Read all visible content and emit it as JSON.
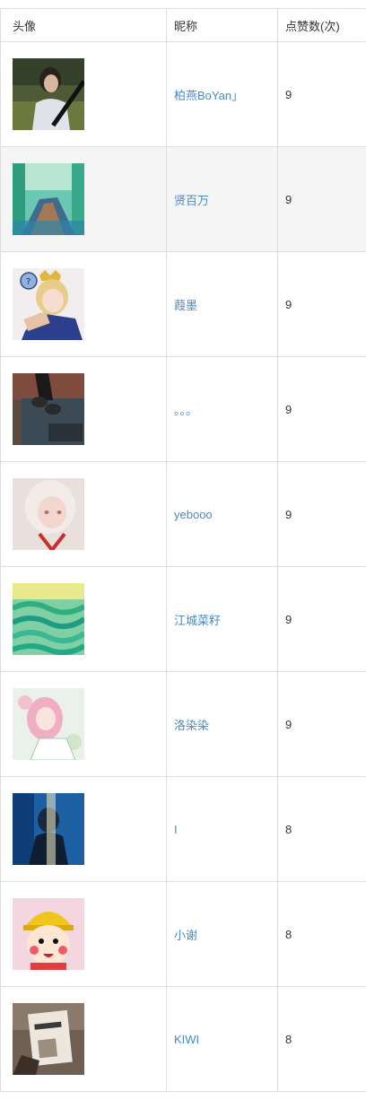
{
  "table": {
    "headers": {
      "avatar": "头像",
      "nickname": "昵称",
      "likes": "点赞数(次)"
    },
    "rows": [
      {
        "nickname": "柏燕BoYan」",
        "likes": "9",
        "avatar_icon": "avatar-photo-girl-outdoor"
      },
      {
        "nickname": "贤百万",
        "likes": "9",
        "avatar_icon": "avatar-illustration-forest-path"
      },
      {
        "nickname": "葭墨",
        "likes": "9",
        "avatar_icon": "avatar-anime-crowned-boy"
      },
      {
        "nickname": "。。。",
        "likes": "9",
        "avatar_icon": "avatar-photo-feet-sign"
      },
      {
        "nickname": "yebooo",
        "likes": "9",
        "avatar_icon": "avatar-anime-white-hair-girl"
      },
      {
        "nickname": "江城菜籽",
        "likes": "9",
        "avatar_icon": "avatar-painted-green-waves"
      },
      {
        "nickname": "洛染染",
        "likes": "9",
        "avatar_icon": "avatar-anime-pink-hair-girl"
      },
      {
        "nickname": "I",
        "likes": "8",
        "avatar_icon": "avatar-photo-blue-portrait"
      },
      {
        "nickname": "小谢",
        "likes": "8",
        "avatar_icon": "avatar-cartoon-maruko"
      },
      {
        "nickname": "KIWI",
        "likes": "8",
        "avatar_icon": "avatar-photo-book-bear"
      }
    ]
  },
  "colors": {
    "link": "#4a89c3",
    "border": "#dddddd",
    "alt_row": "#f5f5f5"
  }
}
